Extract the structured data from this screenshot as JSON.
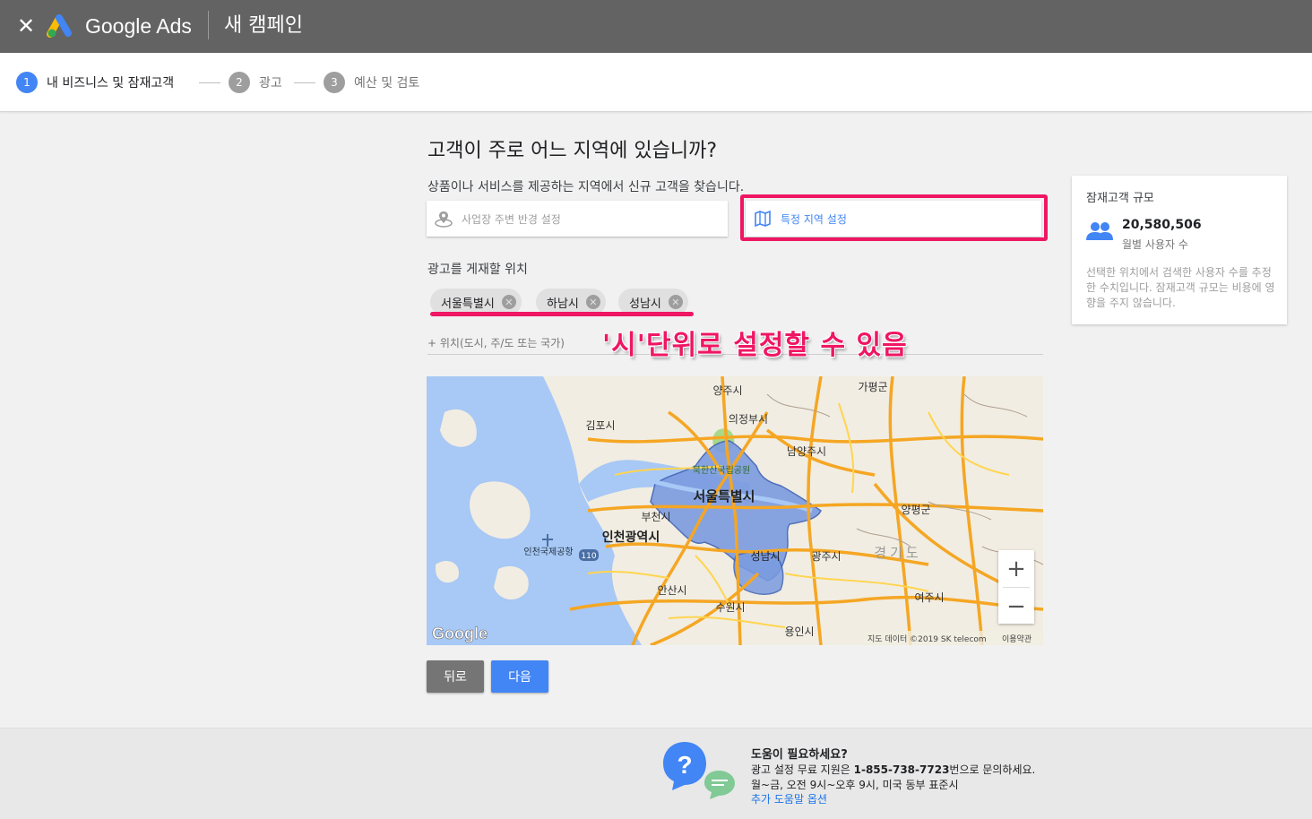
{
  "header": {
    "close_label": "✕",
    "brand": "Google Ads",
    "campaign_title": "새 캠페인"
  },
  "stepper": {
    "steps": [
      {
        "num": "1",
        "label": "내 비즈니스 및 잠재고객",
        "active": true
      },
      {
        "num": "2",
        "label": "광고",
        "active": false
      },
      {
        "num": "3",
        "label": "예산 및 검토",
        "active": false
      }
    ]
  },
  "main": {
    "question": "고객이 주로 어느 지역에 있습니까?",
    "subtitle": "상품이나 서비스를 제공하는 지역에서 신규 고객을 찾습니다.",
    "options": [
      {
        "label": "사업장 주변 반경 설정",
        "icon": "location-radius-icon",
        "selected": false
      },
      {
        "label": "특정 지역 설정",
        "icon": "map-icon",
        "selected": true
      }
    ],
    "locations_heading": "광고를 게재할 위치",
    "chips": [
      "서울특별시",
      "하남시",
      "성남시"
    ],
    "add_location_placeholder": "+ 위치(도시, 주/도 또는 국가)",
    "annotation": "'시'단위로 설정할 수 있음"
  },
  "map": {
    "labels": {
      "yangju": "양주시",
      "gapyeong": "가평군",
      "gimpo": "김포시",
      "uijeongbu": "의정부시",
      "namyangju": "남양주시",
      "bukhansan": "북한산국립공원",
      "seoul": "서울특별시",
      "bucheon": "부천시",
      "yangpyeong": "양평군",
      "incheon": "인천광역시",
      "incheon_airport": "인천국제공항",
      "route_110": "110",
      "gwangju": "광주시",
      "gyeonggi": "경기도",
      "seongnam": "성남시",
      "ansan": "안산시",
      "yeoju": "여주시",
      "suwon": "수원시",
      "yongin": "용인시"
    },
    "google_logo": "Google",
    "attribution": "지도 데이터 ©2019 SK telecom",
    "terms": "이용약관",
    "zoom_in": "+",
    "zoom_out": "−"
  },
  "buttons": {
    "back": "뒤로",
    "next": "다음"
  },
  "audience": {
    "title": "잠재고객 규모",
    "count": "20,580,506",
    "unit": "월별 사용자 수",
    "description": "선택한 위치에서 검색한 사용자 수를 추정한 수치입니다. 잠재고객 규모는 비용에 영향을 주지 않습니다."
  },
  "footer": {
    "title": "도움이 필요하세요?",
    "line1_prefix": "광고 설정 무료 지원은 ",
    "phone": "1-855-738-7723",
    "line1_suffix": "번으로 문의하세요.",
    "line2": "월~금, 오전 9시~오후 9시, 미국 동부 표준시",
    "link": "추가 도움말 옵션"
  },
  "colors": {
    "accent_blue": "#4285f4",
    "highlight_pink": "#ef1663",
    "topbar_gray": "#636363",
    "seoul_fill": "#7b9be0"
  }
}
